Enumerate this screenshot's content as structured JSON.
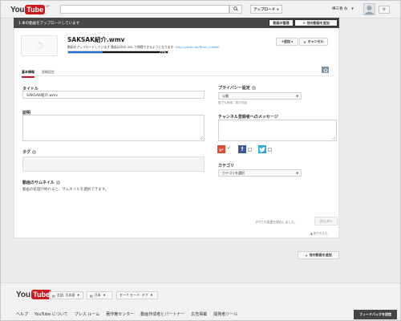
{
  "masthead": {
    "logo_you": "You",
    "logo_tube": "Tube",
    "logo_region": "JP",
    "search_placeholder": "",
    "upload_label": "アップロード",
    "user_name": "樺三春 糸",
    "user_caret": "▼"
  },
  "status_bar": {
    "text": "1 本の動画をアップロードしています",
    "manage_label": "動画の管理",
    "add_more_label": "他の動画を追加"
  },
  "upload": {
    "file_title": "SAKSAK紹介.wmv",
    "message": "動画をアップロードしています 動画は次の URL で視聴できるようになります: ",
    "link": "http://youtu.be/fKmn_a1WkE",
    "progress_percent": 77,
    "progress_label": "77%",
    "add_label": "+追加",
    "cancel_label": "キャンセル"
  },
  "tabs": [
    {
      "label": "基本情報"
    },
    {
      "label": "詳細設定"
    }
  ],
  "form": {
    "title_label": "タイトル",
    "title_value": "SAKSAK紹介.wmv",
    "description_label": "説明",
    "description_value": "",
    "tags_label": "タグ",
    "thumbnail_label": "動画のサムネイル",
    "thumbnail_hint": "動画の処理が終わると、サムネイルを選択できます。",
    "help": "?"
  },
  "privacy": {
    "label": "プライバシー設定",
    "value": "公開",
    "note": "誰でも検索、表示可能"
  },
  "channel_message": {
    "label": "チャンネル登録者へのメッセージ",
    "value": "",
    "gplus_label": "g+",
    "fb_label": "f"
  },
  "category": {
    "label": "カテゴリ",
    "value": "カテゴリを選択"
  },
  "save": {
    "unsaved_text": "すべての変更を保存しました。",
    "save_label": "保存済み",
    "collapse_label": "▲ 折りたたむ"
  },
  "bottom": {
    "add_more_label": "他の動画を追加"
  },
  "footer": {
    "language_label": "言語: 日本語",
    "country_label": "日本",
    "safety_label": "セーフ モード: オフ",
    "links": [
      "ヘルプ",
      "YouTube について",
      "プレス ルーム",
      "著作権センター",
      "動画作成者とパートナー",
      "広告掲載",
      "開発者ツール"
    ],
    "feedback_label": "フィードバックを送信"
  },
  "colors": {
    "brand_red": "#cc181e",
    "status_bar": "#484848",
    "progress": "#1e6ed8",
    "link": "#2793e6"
  }
}
